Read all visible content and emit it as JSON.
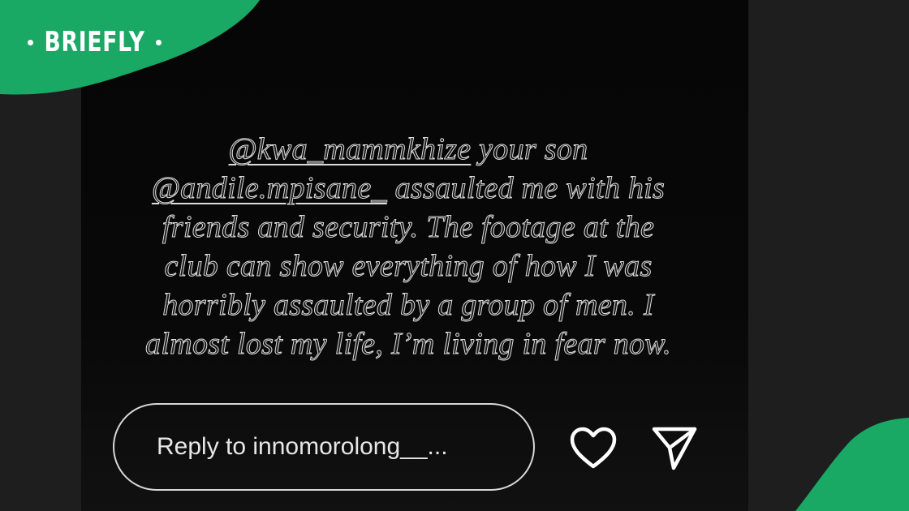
{
  "brand": {
    "name": "BRIEFLY",
    "color": "#1aa865"
  },
  "story": {
    "lines": [
      {
        "mention": "@kwa_mammkhize",
        "text": " your son"
      },
      {
        "mention": "@andile.mpisane_",
        "text": "  assaulted me with his"
      },
      {
        "mention": "",
        "text": "friends and security. The footage at the"
      },
      {
        "mention": "",
        "text": "club can show everything of how I was"
      },
      {
        "mention": "",
        "text": "horribly assaulted by a group of men. I"
      },
      {
        "mention": "",
        "text": "almost lost my life, I’m living in fear now."
      }
    ]
  },
  "reply": {
    "placeholder": "Reply to innomorolong__..."
  },
  "icons": {
    "like": "heart-icon",
    "share": "send-icon"
  }
}
